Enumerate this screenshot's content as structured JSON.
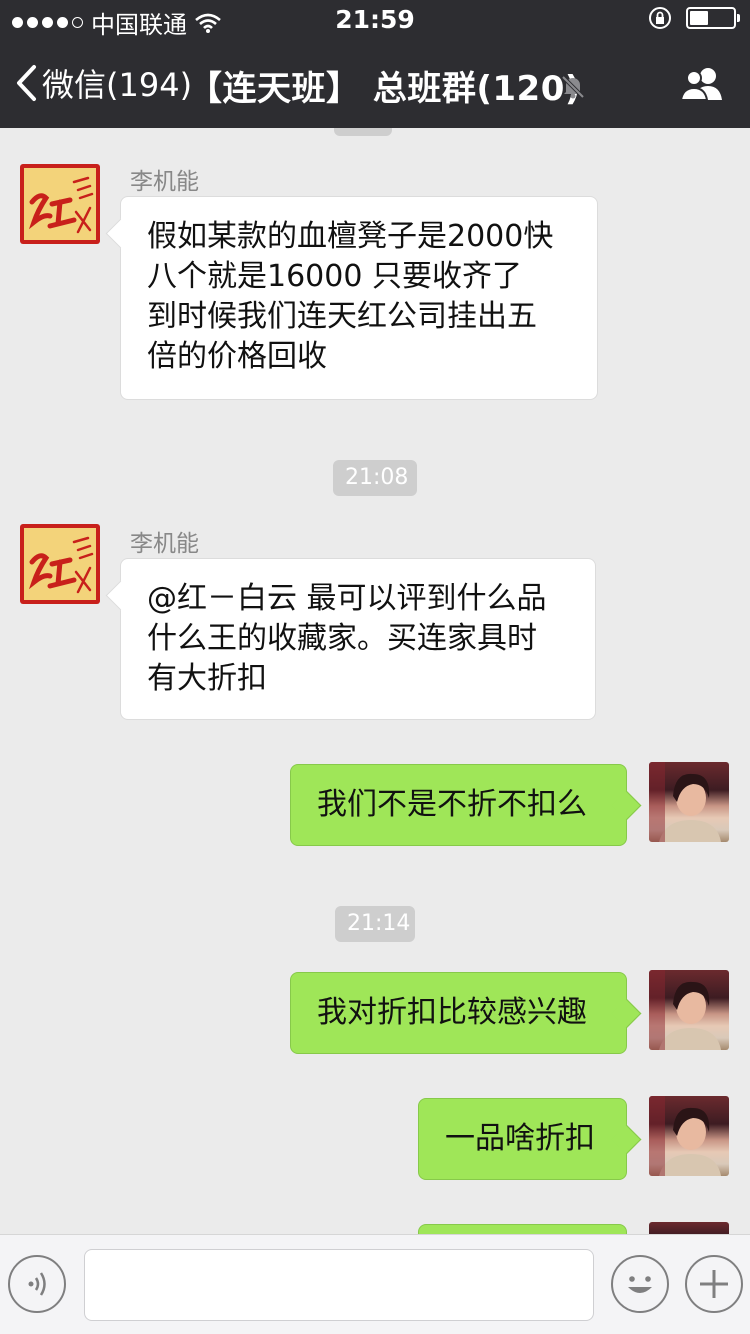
{
  "status_bar": {
    "carrier": "中国联通",
    "time": "21:59"
  },
  "nav": {
    "back_label": "微信(194)",
    "title": "【连天班】 总班群(120)"
  },
  "messages": [
    {
      "sender": "李机能",
      "text": "假如某款的血檀凳子是2000快\n八个就是16000 只要收齐了\n到时候我们连天红公司挂出五\n倍的价格回收"
    },
    {
      "timestamp": "21:08"
    },
    {
      "sender": "李机能",
      "text": "@红－白云 最可以评到什么品\n什么王的收藏家。买连家具时\n有大折扣"
    },
    {
      "self": true,
      "text": "我们不是不折不扣么"
    },
    {
      "timestamp": "21:14"
    },
    {
      "self": true,
      "text": "我对折扣比较感兴趣"
    },
    {
      "self": true,
      "text": "一品啥折扣"
    }
  ],
  "icons": {
    "back": "chevron-left-icon",
    "mute": "bell-muted-icon",
    "group": "group-members-icon",
    "voice": "voice-icon",
    "emoji": "emoji-icon",
    "add": "plus-icon"
  },
  "colors": {
    "bar": "#2d2d31",
    "chat_bg": "#ebebeb",
    "self_bubble": "#9fe658",
    "other_bubble": "#ffffff",
    "logo_red": "#c8201b"
  }
}
